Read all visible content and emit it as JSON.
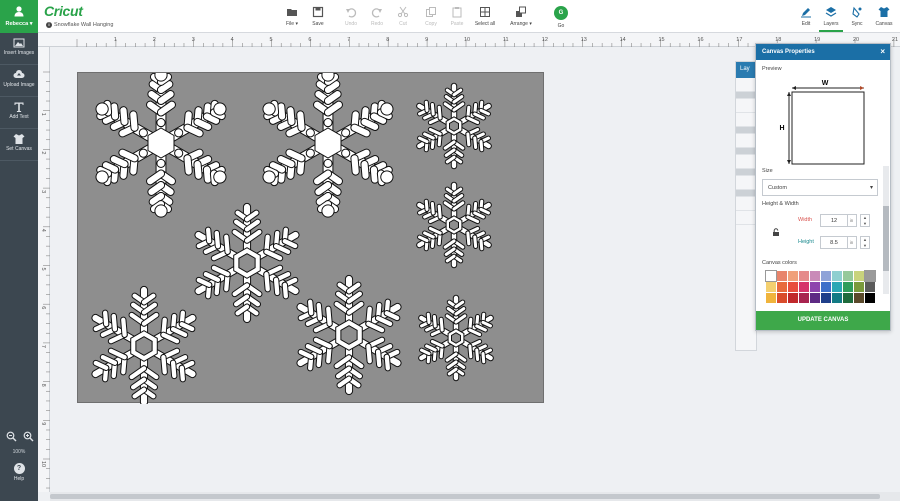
{
  "user": {
    "name": "Rebecca"
  },
  "brand": {
    "logo": "Cricut",
    "project_title": "Snowflake Wall Hanging",
    "info_icon": "i"
  },
  "toolbar": [
    {
      "name": "file",
      "label": "File",
      "icon": "folder-icon",
      "disabled": false
    },
    {
      "name": "save",
      "label": "Save",
      "icon": "save-icon",
      "disabled": false
    },
    {
      "name": "undo",
      "label": "Undo",
      "icon": "undo-icon",
      "disabled": true
    },
    {
      "name": "redo",
      "label": "Redo",
      "icon": "redo-icon",
      "disabled": true
    },
    {
      "name": "cut",
      "label": "Cut",
      "icon": "cut-icon",
      "disabled": true
    },
    {
      "name": "copy",
      "label": "Copy",
      "icon": "copy-icon",
      "disabled": true
    },
    {
      "name": "paste",
      "label": "Paste",
      "icon": "paste-icon",
      "disabled": true
    },
    {
      "name": "select_all",
      "label": "Select all",
      "icon": "select-all-icon",
      "disabled": false
    },
    {
      "name": "arrange",
      "label": "Arrange",
      "icon": "arrange-icon",
      "disabled": false
    }
  ],
  "go": {
    "label": "Go",
    "badge": "G"
  },
  "right_tabs": [
    {
      "label": "Edit",
      "icon": "edit-icon"
    },
    {
      "label": "Layers",
      "icon": "layers-icon"
    },
    {
      "label": "Sync",
      "icon": "sync-icon"
    },
    {
      "label": "Canvas",
      "icon": "tshirt-icon"
    }
  ],
  "sidebar": {
    "items": [
      {
        "label": "Insert Images",
        "icon": "image-icon"
      },
      {
        "label": "Upload Image",
        "icon": "upload-icon"
      },
      {
        "label": "Add Text",
        "icon": "text-icon"
      },
      {
        "label": "Set Canvas",
        "icon": "tshirt-icon"
      }
    ],
    "zoom_level": "100%",
    "help_label": "Help"
  },
  "ruler": {
    "h_labels": [
      "1",
      "2",
      "3",
      "4",
      "5",
      "6",
      "7",
      "8",
      "9",
      "10",
      "11",
      "12",
      "13",
      "14",
      "15",
      "16",
      "17",
      "18",
      "19",
      "20",
      "21"
    ],
    "v_labels": [
      "1",
      "2",
      "3",
      "4",
      "5",
      "6",
      "7",
      "8",
      "9",
      "10",
      "11"
    ]
  },
  "layers_panel": {
    "title": "Lay",
    "group_label": "Sn"
  },
  "canvas_properties": {
    "title": "Canvas Properties",
    "close": "×",
    "preview_label": "Preview",
    "preview_w": "W",
    "preview_h": "H",
    "size_label": "Size",
    "size_value": "Custom",
    "hw_label": "Height & Width",
    "width_label": "Width",
    "width_value": "12",
    "height_label": "Height",
    "height_value": "8.5",
    "unit": "in",
    "colors_label": "Canvas colors",
    "update_button": "UPDATE CANVAS",
    "colors": {
      "width_label": "#d9534f",
      "height_label": "#1b8a8f"
    },
    "swatches": [
      "#ffffff",
      "#e8846b",
      "#f0a07a",
      "#e58b8b",
      "#c98ab8",
      "#8fa3d8",
      "#8fcfd0",
      "#96c99a",
      "#c9d37c",
      "#9a9a9a",
      "#f4d06f",
      "#e86a3d",
      "#e84d3d",
      "#d6336a",
      "#8e44ad",
      "#3d6fc9",
      "#2ba8b5",
      "#2f9e5c",
      "#7a9a3c",
      "#5a5a5a",
      "#f0b43c",
      "#d94c2b",
      "#c0282b",
      "#a8244f",
      "#5e2a84",
      "#1f3f8a",
      "#137b85",
      "#1e6b3c",
      "#5b4a2b",
      "#000000"
    ]
  }
}
